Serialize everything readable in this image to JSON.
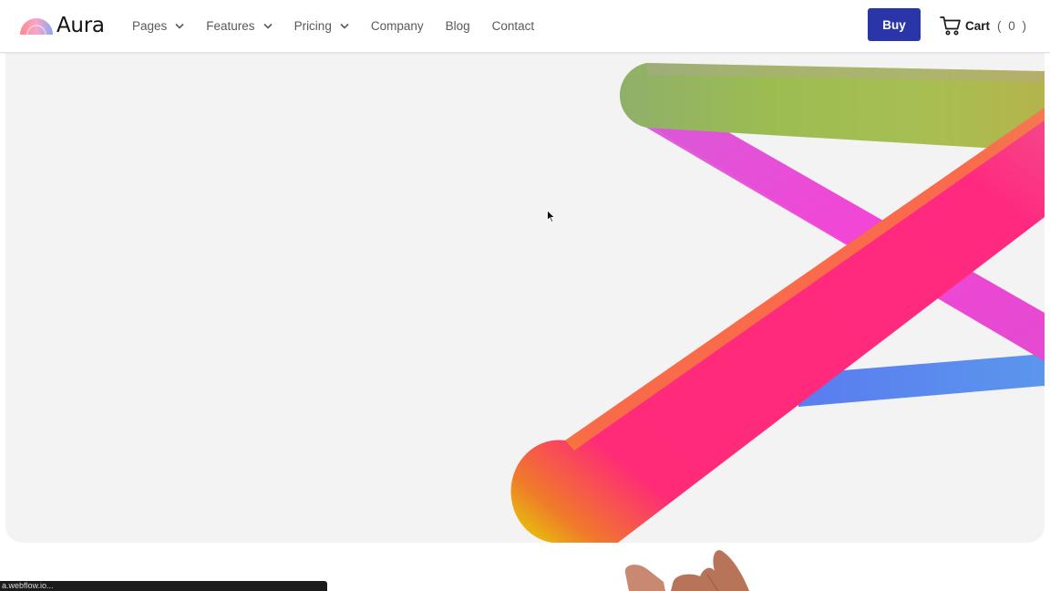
{
  "brand": {
    "name": "Aura",
    "logo_icon": "rainbow-arc-icon"
  },
  "nav": {
    "items": [
      {
        "label": "Pages",
        "has_dropdown": true
      },
      {
        "label": "Features",
        "has_dropdown": true
      },
      {
        "label": "Pricing",
        "has_dropdown": true
      },
      {
        "label": "Company",
        "has_dropdown": false
      },
      {
        "label": "Blog",
        "has_dropdown": false
      },
      {
        "label": "Contact",
        "has_dropdown": false
      }
    ]
  },
  "actions": {
    "buy_label": "Buy",
    "cart_label": "Cart",
    "cart_count": "( 0 )"
  },
  "status_bar": {
    "text": "a.webflow.io..."
  },
  "colors": {
    "accent": "#2a35a8",
    "hero_bg": "#f3f3f4",
    "tube_pink": "#ff2a7a",
    "tube_magenta": "#f04ad8",
    "tube_green": "#9cbc52",
    "tube_blue": "#5a8af0",
    "tube_yellow": "#e4d800"
  }
}
